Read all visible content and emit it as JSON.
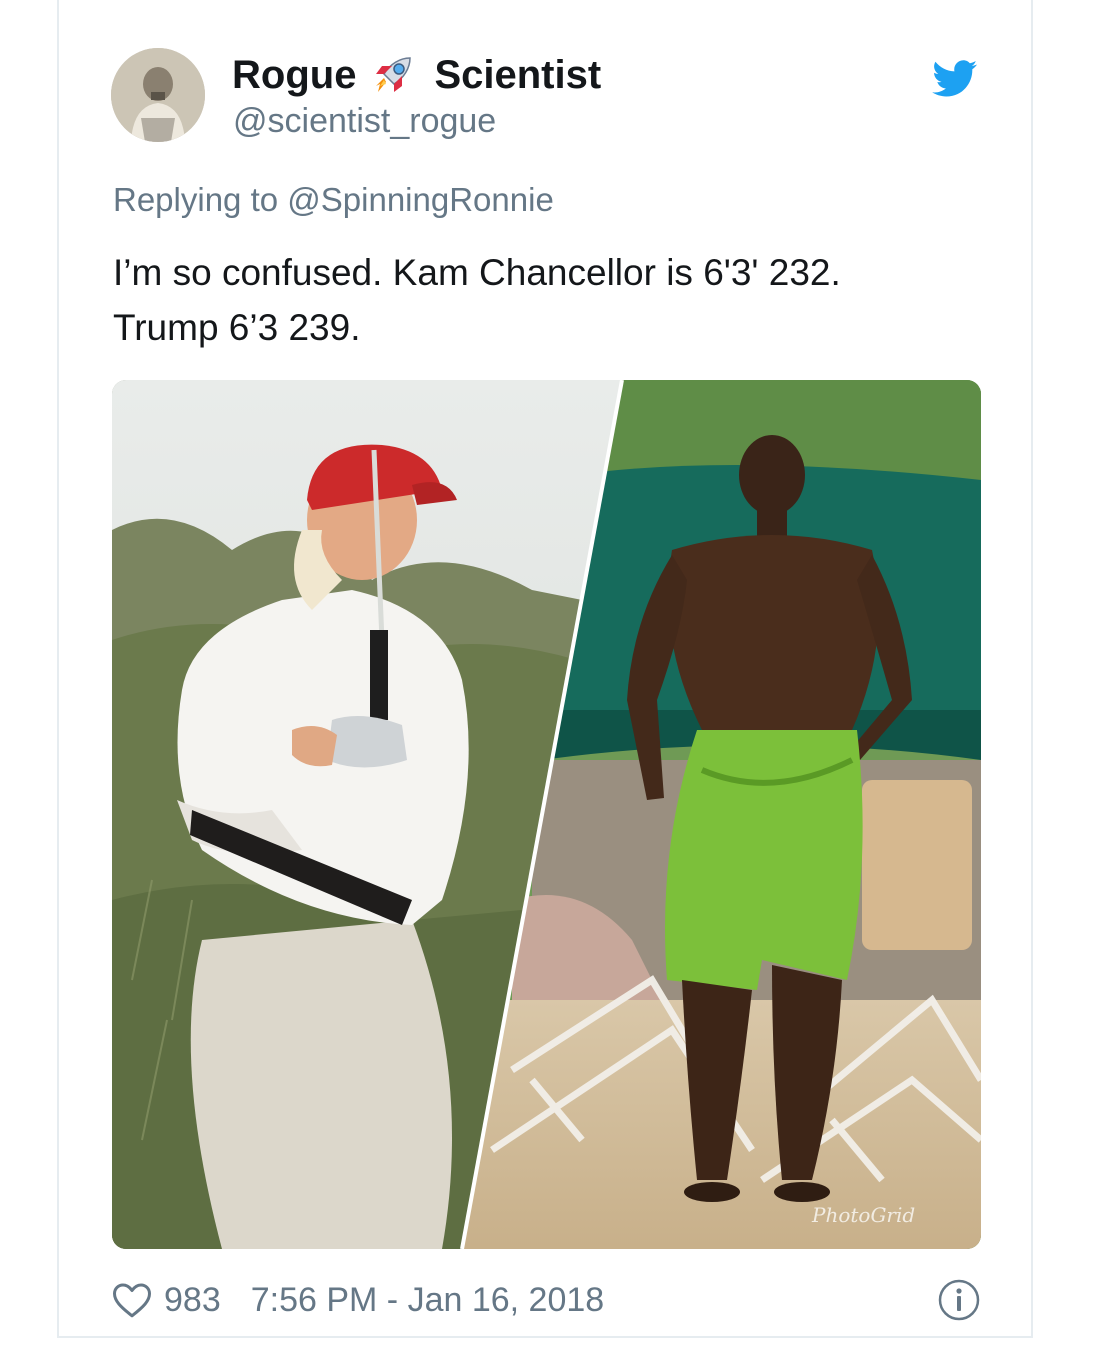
{
  "tweet": {
    "display_name_first": "Rogue",
    "display_name_emoji": "rocket-emoji",
    "display_name_second": "Scientist",
    "handle": "@scientist_rogue",
    "reply_prefix": "Replying to",
    "reply_to": "@SpinningRonnie",
    "text_line1": "I’m so confused. Kam Chancellor is 6'3' 232.",
    "text_line2": "Trump 6’3 239.",
    "photo_watermark": "PhotoGrid"
  },
  "footer": {
    "like_count": "983",
    "timestamp": "7:56 PM - Jan 16, 2018"
  },
  "icons": {
    "brand": "twitter-bird-icon",
    "like": "heart-icon",
    "info": "info-icon"
  },
  "colors": {
    "twitter_blue": "#1da1f2",
    "secondary_text": "#657786",
    "primary_text": "#14171a",
    "border": "#e6ecf0"
  }
}
